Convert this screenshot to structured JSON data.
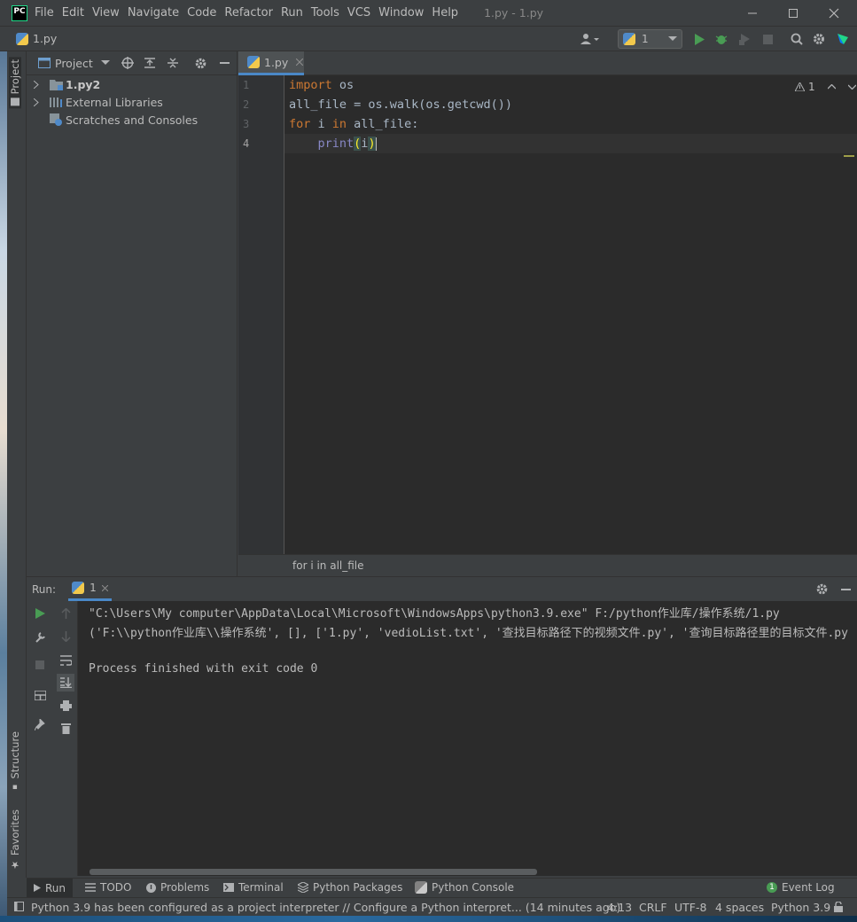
{
  "app": {
    "logo_text": "PC",
    "window_title": "1.py - 1.py",
    "menu": [
      "File",
      "Edit",
      "View",
      "Navigate",
      "Code",
      "Refactor",
      "Run",
      "Tools",
      "VCS",
      "Window",
      "Help"
    ]
  },
  "navbar": {
    "breadcrumb": "1.py",
    "run_config": "1"
  },
  "sidebar": {
    "project_tab": "Project",
    "structure_tab": "Structure",
    "favorites_tab": "Favorites"
  },
  "project": {
    "header": "Project",
    "tree": [
      {
        "label": "1.py2"
      },
      {
        "label": "External Libraries"
      },
      {
        "label": "Scratches and Consoles"
      }
    ]
  },
  "editor": {
    "tab": "1.py",
    "warning_count": "1",
    "line_numbers": [
      "1",
      "2",
      "3",
      "4"
    ],
    "code": {
      "l1_kw": "import",
      "l1_rest": " os",
      "l2": "all_file = os.walk(os.getcwd())",
      "l3_kw1": "for",
      "l3_a": " i ",
      "l3_kw2": "in",
      "l3_b": " all_file:",
      "l4_indent": "    ",
      "l4_fn": "print",
      "l4_open": "(",
      "l4_arg": "i",
      "l4_close": ")"
    },
    "breadcrumb": "for i in all_file"
  },
  "run": {
    "label": "Run:",
    "tab": "1",
    "output": [
      "\"C:\\Users\\My computer\\AppData\\Local\\Microsoft\\WindowsApps\\python3.9.exe\" F:/python作业库/操作系统/1.py",
      "('F:\\\\python作业库\\\\操作系统', [], ['1.py', 'vedioList.txt', '查找目标路径下的视频文件.py', '查询目标路径里的目标文件.py",
      "",
      "Process finished with exit code 0"
    ]
  },
  "bottom_tabs": [
    "Run",
    "TODO",
    "Problems",
    "Terminal",
    "Python Packages",
    "Python Console"
  ],
  "event_log": {
    "count": "1",
    "label": "Event Log"
  },
  "status": {
    "message": "Python 3.9 has been configured as a project interpreter // Configure a Python interpret... (14 minutes ago)",
    "position": "4:13",
    "line_sep": "CRLF",
    "encoding": "UTF-8",
    "indent": "4 spaces",
    "interpreter": "Python 3.9"
  },
  "colors": {
    "bg": "#3c3f41",
    "editor_bg": "#2b2b2b",
    "keyword": "#cc7832",
    "builtin": "#8888c6",
    "run_green": "#499c54"
  }
}
